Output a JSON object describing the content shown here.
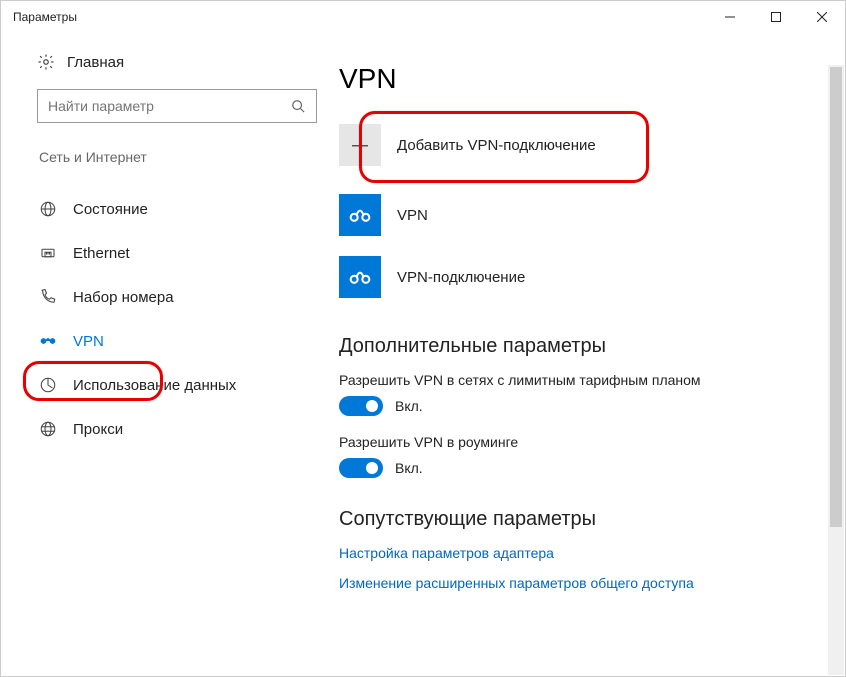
{
  "window": {
    "title": "Параметры"
  },
  "sidebar": {
    "home_label": "Главная",
    "search_placeholder": "Найти параметр",
    "category": "Сеть и Интернет",
    "items": [
      {
        "id": "status",
        "label": "Состояние"
      },
      {
        "id": "ethernet",
        "label": "Ethernet"
      },
      {
        "id": "dialup",
        "label": "Набор номера"
      },
      {
        "id": "vpn",
        "label": "VPN"
      },
      {
        "id": "datausage",
        "label": "Использование данных"
      },
      {
        "id": "proxy",
        "label": "Прокси"
      }
    ]
  },
  "main": {
    "page_title": "VPN",
    "add_label": "Добавить VPN-подключение",
    "connections": [
      {
        "label": "VPN"
      },
      {
        "label": "VPN-подключение"
      }
    ],
    "advanced_heading": "Дополнительные параметры",
    "settings": [
      {
        "label": "Разрешить VPN в сетях с лимитным тарифным планом",
        "state": "Вкл."
      },
      {
        "label": "Разрешить VPN в роуминге",
        "state": "Вкл."
      }
    ],
    "related_heading": "Сопутствующие параметры",
    "links": [
      "Настройка параметров адаптера",
      "Изменение расширенных параметров общего доступа"
    ]
  }
}
